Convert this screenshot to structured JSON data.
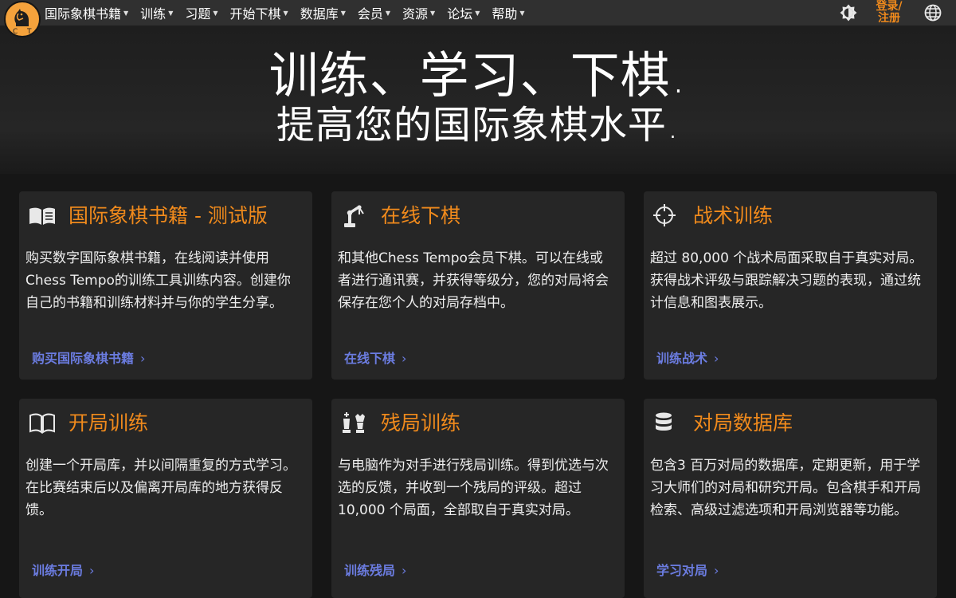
{
  "navbar": {
    "logo_text": "CT",
    "menu": [
      {
        "label": "国际象棋书籍"
      },
      {
        "label": "训练"
      },
      {
        "label": "习题"
      },
      {
        "label": "开始下棋"
      },
      {
        "label": "数据库"
      },
      {
        "label": "会员"
      },
      {
        "label": "资源"
      },
      {
        "label": "论坛"
      },
      {
        "label": "帮助"
      }
    ],
    "theme_icon": "brightness-icon",
    "login_line1": "登录/",
    "login_line2": "注册",
    "language_icon": "globe-icon"
  },
  "hero": {
    "line1": "训练、学习、下棋.",
    "line2": "提高您的国际象棋水平."
  },
  "cards": [
    {
      "icon": "book-icon",
      "title": "国际象棋书籍 - 测试版",
      "description": "购买数字国际象棋书籍，在线阅读并使用Chess Tempo的训练工具训练内容。创建你自己的书籍和训练材料并与你的学生分享。",
      "link": "购买国际象棋书籍"
    },
    {
      "icon": "robot-arm-icon",
      "title": "在线下棋",
      "description": "和其他Chess Tempo会员下棋。可以在线或者进行通讯赛，并获得等级分，您的对局将会保存在您个人的对局存档中。",
      "link": "在线下棋"
    },
    {
      "icon": "crosshair-icon",
      "title": "战术训练",
      "description": "超过 80,000 个战术局面采取自于真实对局。获得战术评级与跟踪解决习题的表现，通过统计信息和图表展示。",
      "link": "训练战术"
    },
    {
      "icon": "open-book-icon",
      "title": "开局训练",
      "description": "创建一个开局库，并以间隔重复的方式学习。 在比赛结束后以及偏离开局库的地方获得反馈。",
      "link": "训练开局"
    },
    {
      "icon": "chess-pieces-icon",
      "title": "残局训练",
      "description": "与电脑作为对手进行残局训练。得到优选与次选的反馈，并收到一个残局的评级。超过 10,000 个局面，全部取自于真实对局。",
      "link": "训练残局"
    },
    {
      "icon": "database-icon",
      "title": "对局数据库",
      "description": "包含3 百万对局的数据库，定期更新，用于学习大师们的对局和研究开局。包含棋手和开局检索、高级过滤选项和开局浏览器等功能。",
      "link": "学习对局"
    }
  ],
  "colors": {
    "accent_orange": "#f08a1c",
    "link_blue": "#6b7ce0",
    "card_bg": "#262626",
    "page_bg": "#161616"
  }
}
